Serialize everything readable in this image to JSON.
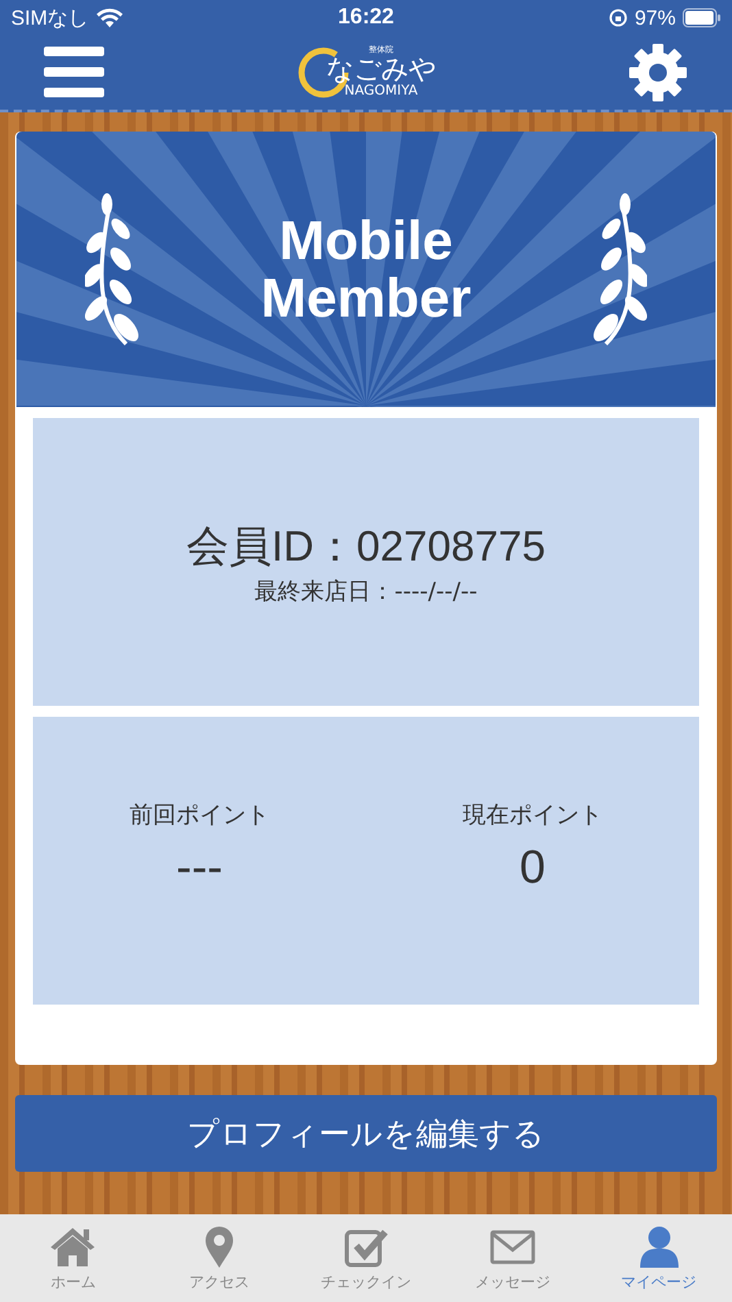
{
  "status_bar": {
    "carrier": "SIMなし",
    "time": "16:22",
    "battery": "97%"
  },
  "header": {
    "logo": {
      "subtitle": "整体院",
      "name": "なごみや",
      "romaji": "NAGOMIYA"
    }
  },
  "card": {
    "banner_title": "Mobile Member",
    "member_id": "会員ID：02708775",
    "last_visit": "最終来店日：----/--/--",
    "points": [
      {
        "label": "前回ポイント",
        "value": "---"
      },
      {
        "label": "現在ポイント",
        "value": "0"
      }
    ]
  },
  "edit_button": "プロフィールを編集する",
  "tabs": [
    {
      "label": "ホーム",
      "kind": "home",
      "selected": false
    },
    {
      "label": "アクセス",
      "kind": "pin",
      "selected": false
    },
    {
      "label": "チェックイン",
      "kind": "check",
      "selected": false
    },
    {
      "label": "メッセージ",
      "kind": "mail",
      "selected": false
    },
    {
      "label": "マイページ",
      "kind": "person",
      "selected": true
    }
  ]
}
